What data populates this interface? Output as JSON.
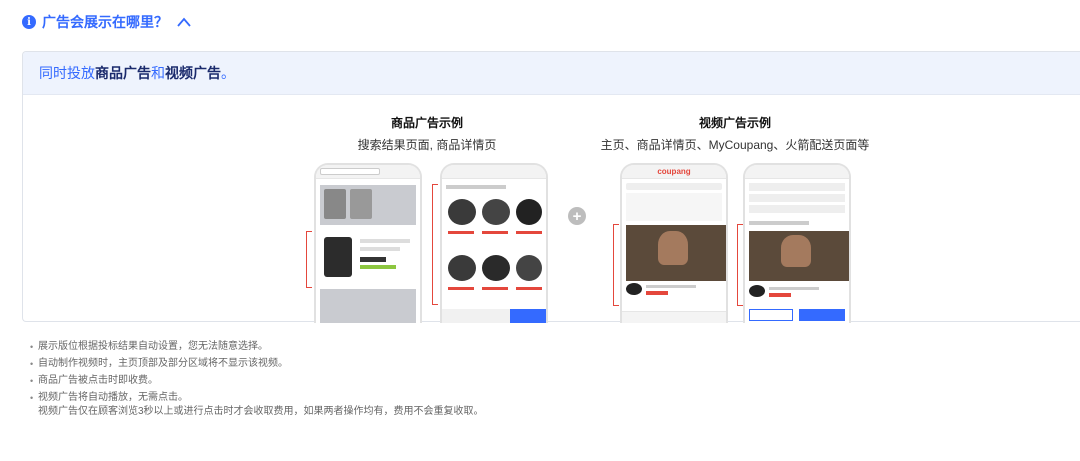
{
  "faq": {
    "title": "广告会展示在哪里？",
    "expanded": true
  },
  "panel": {
    "head_prefix": "同时投放",
    "head_product": "商品广告",
    "head_and": "和",
    "head_video": "视频广告",
    "head_suffix": "。"
  },
  "product_example": {
    "title": "商品广告示例",
    "subtitle": "搜索结果页面, 商品详情页"
  },
  "video_example": {
    "title": "视频广告示例",
    "subtitle": "主页、商品详情页、MyCoupang、火箭配送页面等"
  },
  "mock": {
    "logo": "coupang"
  },
  "notes": [
    "展示版位根据投标结果自动设置，您无法随意选择。",
    "自动制作视频时，主页顶部及部分区域将不显示该视频。",
    "商品广告被点击时即收费。",
    "视频广告将自动播放，无需点击。",
    "视频广告仅在顾客浏览3秒以上或进行点击时才会收取费用，如果两者操作均有，费用不会重复收取。"
  ],
  "colors": {
    "accent": "#346aff",
    "panel_head_bg": "#eef3fd",
    "bracket": "#e4473c"
  }
}
